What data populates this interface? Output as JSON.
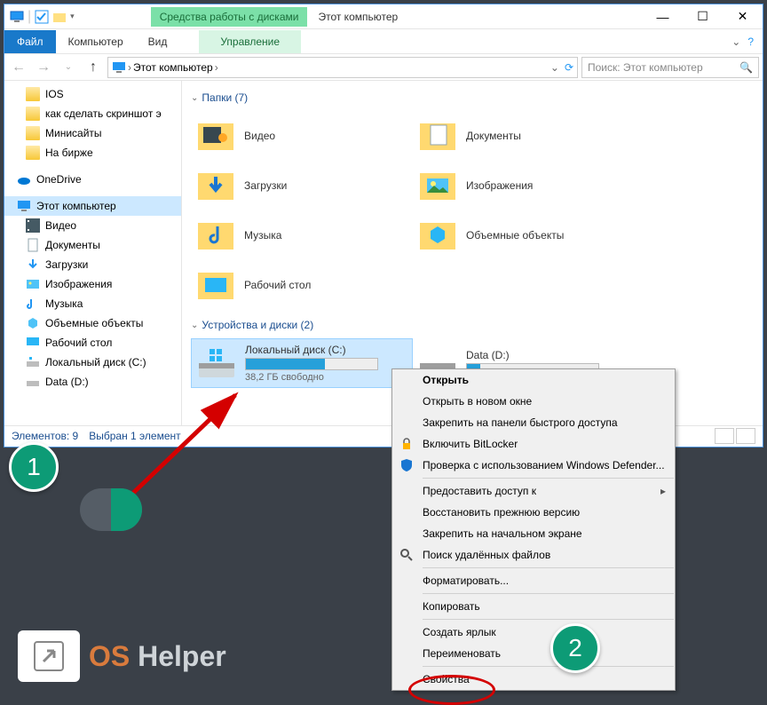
{
  "window": {
    "ribbon_context": "Средства работы с дисками",
    "title": "Этот компьютер",
    "tabs": {
      "file": "Файл",
      "computer": "Компьютер",
      "view": "Вид",
      "manage": "Управление"
    }
  },
  "breadcrumb": {
    "root": "Этот компьютер"
  },
  "search": {
    "placeholder": "Поиск: Этот компьютер"
  },
  "sidebar": {
    "quick": [
      {
        "label": "IOS"
      },
      {
        "label": "как сделать скриншот э"
      },
      {
        "label": "Минисайты"
      },
      {
        "label": "На бирже"
      }
    ],
    "onedrive": "OneDrive",
    "thispc": "Этот компьютер",
    "pc_children": [
      "Видео",
      "Документы",
      "Загрузки",
      "Изображения",
      "Музыка",
      "Объемные объекты",
      "Рабочий стол",
      "Локальный диск (C:)",
      "Data (D:)"
    ]
  },
  "groups": {
    "folders": {
      "title": "Папки (7)",
      "items": [
        "Видео",
        "Загрузки",
        "Музыка",
        "Рабочий стол",
        "Документы",
        "Изображения",
        "Объемные объекты"
      ]
    },
    "drives": {
      "title": "Устройства и диски (2)",
      "items": [
        {
          "label": "Локальный диск (C:)",
          "sub": "38,2 ГБ свободно",
          "fill": 60
        },
        {
          "label": "Data (D:)",
          "sub": "",
          "fill": 10
        }
      ]
    }
  },
  "status": {
    "count": "Элементов: 9",
    "selection": "Выбран 1 элемент"
  },
  "context_menu": [
    {
      "label": "Открыть",
      "bold": true
    },
    {
      "label": "Открыть в новом окне"
    },
    {
      "label": "Закрепить на панели быстрого доступа"
    },
    {
      "label": "Включить BitLocker",
      "icon": "bitlocker"
    },
    {
      "label": "Проверка с использованием Windows Defender...",
      "icon": "defender"
    },
    {
      "sep": true
    },
    {
      "label": "Предоставить доступ к",
      "sub": true
    },
    {
      "label": "Восстановить прежнюю версию"
    },
    {
      "label": "Закрепить на начальном экране"
    },
    {
      "label": "Поиск удалённых файлов",
      "icon": "search"
    },
    {
      "sep": true
    },
    {
      "label": "Форматировать..."
    },
    {
      "sep": true
    },
    {
      "label": "Копировать"
    },
    {
      "sep": true
    },
    {
      "label": "Создать ярлык"
    },
    {
      "label": "Переименовать"
    },
    {
      "sep": true
    },
    {
      "label": "Свойства",
      "highlight": true
    }
  ],
  "annotations": {
    "badge1": "1",
    "badge2": "2"
  },
  "logo": {
    "os": "OS",
    "helper": " Helper"
  }
}
